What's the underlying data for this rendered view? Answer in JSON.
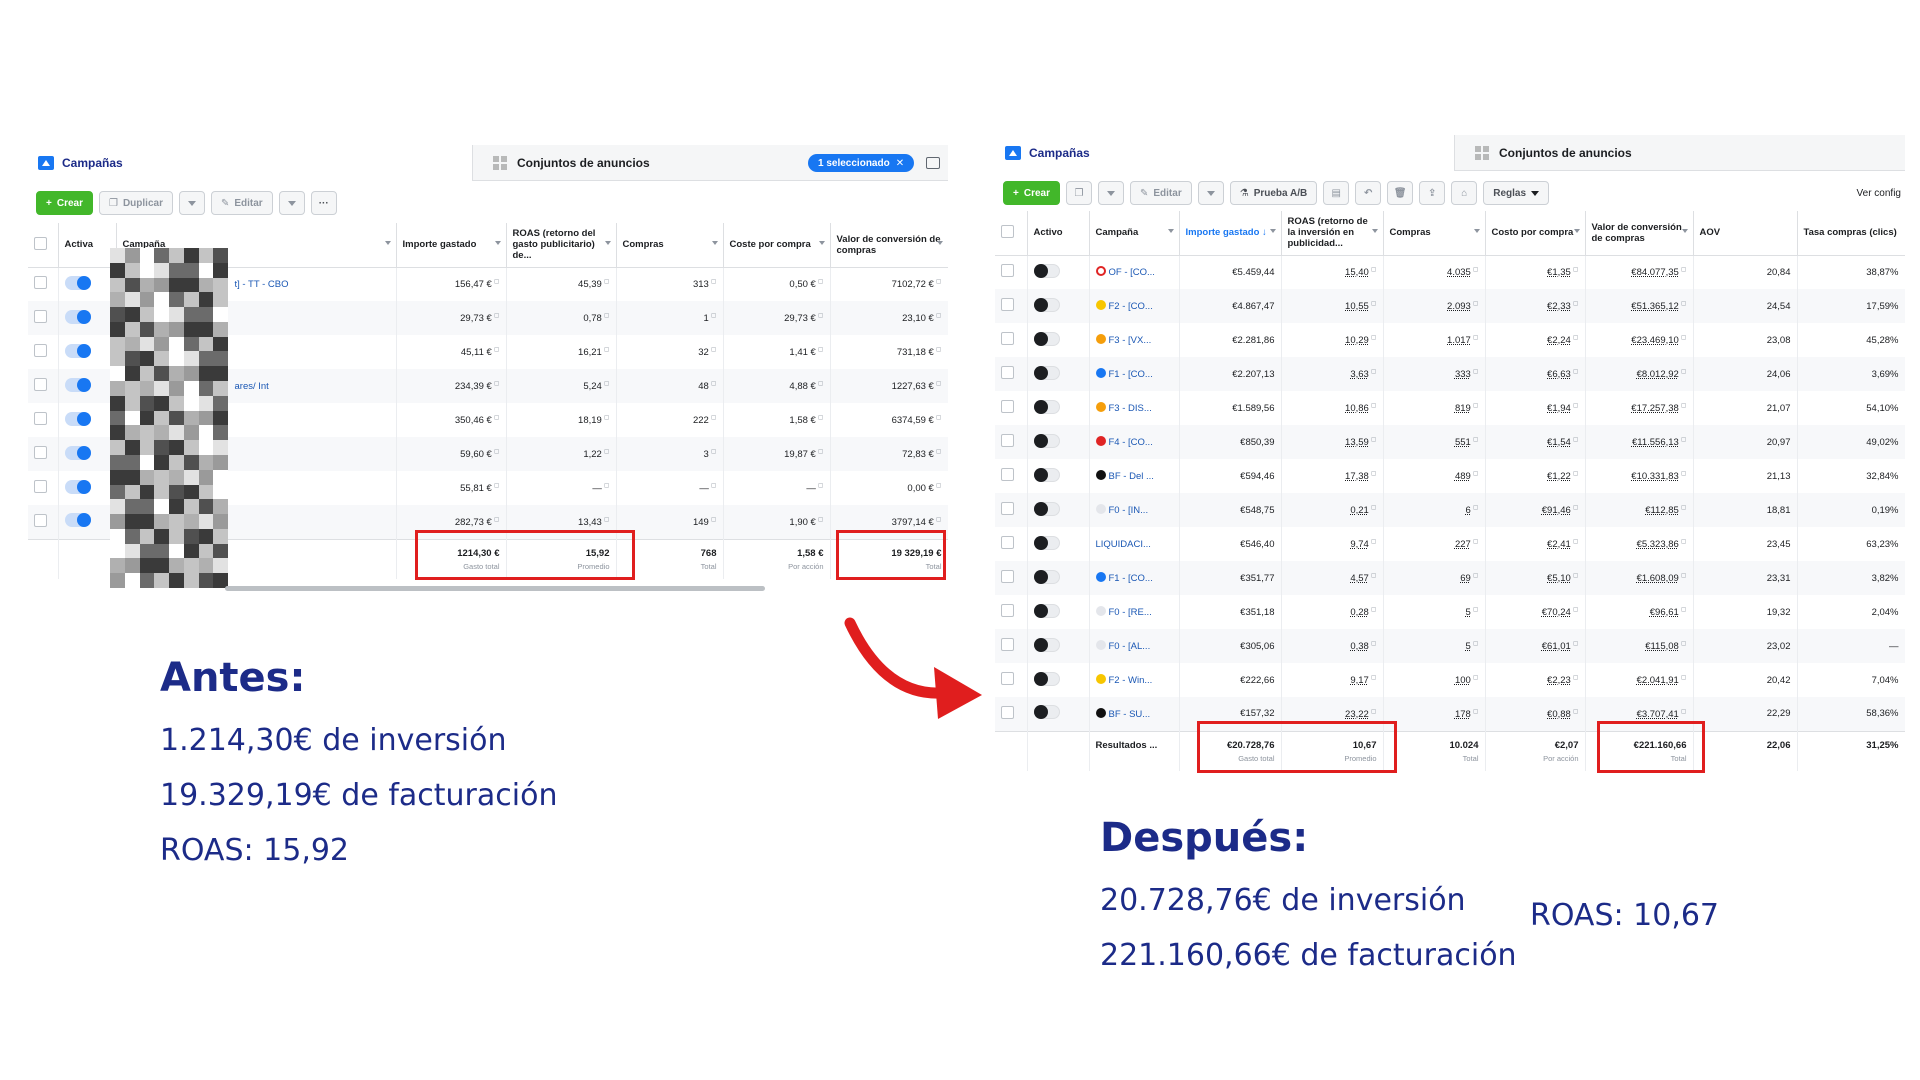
{
  "before": {
    "tabs": {
      "campaigns": "Campañas",
      "adsets": "Conjuntos de anuncios",
      "selected": "1 seleccionado"
    },
    "toolbar": {
      "create": "Crear",
      "duplicate": "Duplicar",
      "edit": "Editar",
      "more": "···"
    },
    "columns": [
      "Activa",
      "Campaña",
      "Importe gastado",
      "ROAS (retorno del gasto publicitario) de...",
      "Compras",
      "Coste por compra",
      "Valor de conversión de compras"
    ],
    "rows": [
      {
        "campaign": "t] - TT - CBO",
        "spend": "156,47 €",
        "roas": "45,39",
        "purchases": "313",
        "cpp": "0,50 €",
        "value": "7102,72 €"
      },
      {
        "campaign": "",
        "spend": "29,73 €",
        "roas": "0,78",
        "purchases": "1",
        "cpp": "29,73 €",
        "value": "23,10 €"
      },
      {
        "campaign": "",
        "spend": "45,11 €",
        "roas": "16,21",
        "purchases": "32",
        "cpp": "1,41 €",
        "value": "731,18 €"
      },
      {
        "campaign": "ares/ Int",
        "spend": "234,39 €",
        "roas": "5,24",
        "purchases": "48",
        "cpp": "4,88 €",
        "value": "1227,63 €"
      },
      {
        "campaign": "",
        "spend": "350,46 €",
        "roas": "18,19",
        "purchases": "222",
        "cpp": "1,58 €",
        "value": "6374,59 €"
      },
      {
        "campaign": "",
        "spend": "59,60 €",
        "roas": "1,22",
        "purchases": "3",
        "cpp": "19,87 €",
        "value": "72,83 €"
      },
      {
        "campaign": "",
        "spend": "55,81 €",
        "roas": "—",
        "purchases": "—",
        "cpp": "—",
        "value": "0,00 €"
      },
      {
        "campaign": "",
        "spend": "282,73 €",
        "roas": "13,43",
        "purchases": "149",
        "cpp": "1,90 €",
        "value": "3797,14 €"
      }
    ],
    "totals": {
      "spend": "1214,30 €",
      "spend_label": "Gasto total",
      "roas": "15,92",
      "roas_label": "Promedio",
      "purchases": "768",
      "purchases_label": "Total",
      "cpp": "1,58 €",
      "cpp_label": "Por acción",
      "value": "19 329,19 €",
      "value_label": "Total"
    }
  },
  "after": {
    "tabs": {
      "campaigns": "Campañas",
      "adsets": "Conjuntos de anuncios"
    },
    "toolbar": {
      "create": "Crear",
      "edit": "Editar",
      "ab_test": "Prueba A/B",
      "rules": "Reglas",
      "view_config": "Ver config"
    },
    "columns": [
      "Activo",
      "Campaña",
      "Importe gastado ↓",
      "ROAS (retorno de la inversión en publicidad...",
      "Compras",
      "Costo por compra",
      "Valor de conversión de compras",
      "AOV",
      "Tasa compras (clics)"
    ],
    "rows": [
      {
        "icon": "clock",
        "color": "#e02424",
        "campaign": "OF - [CO...",
        "spend": "€5.459,44",
        "roas": "15,40",
        "purchases": "4.035",
        "cpp": "€1,35",
        "value": "€84.077,35",
        "aov": "20,84",
        "rate": "38,87%"
      },
      {
        "icon": "dot",
        "color": "#f7c600",
        "campaign": "F2 - [CO...",
        "spend": "€4.867,47",
        "roas": "10,55",
        "purchases": "2.093",
        "cpp": "€2,33",
        "value": "€51.365,12",
        "aov": "24,54",
        "rate": "17,59%"
      },
      {
        "icon": "dot",
        "color": "#f59e0b",
        "campaign": "F3 - [VX...",
        "spend": "€2.281,86",
        "roas": "10,29",
        "purchases": "1.017",
        "cpp": "€2,24",
        "value": "€23.469,10",
        "aov": "23,08",
        "rate": "45,28%"
      },
      {
        "icon": "dot",
        "color": "#1877f2",
        "campaign": "F1 - [CO...",
        "spend": "€2.207,13",
        "roas": "3,63",
        "purchases": "333",
        "cpp": "€6,63",
        "value": "€8.012,92",
        "aov": "24,06",
        "rate": "3,69%"
      },
      {
        "icon": "dot",
        "color": "#f59e0b",
        "campaign": "F3 - DIS...",
        "spend": "€1.589,56",
        "roas": "10,86",
        "purchases": "819",
        "cpp": "€1,94",
        "value": "€17.257,38",
        "aov": "21,07",
        "rate": "54,10%"
      },
      {
        "icon": "dot",
        "color": "#e02424",
        "campaign": "F4 - [CO...",
        "spend": "€850,39",
        "roas": "13,59",
        "purchases": "551",
        "cpp": "€1,54",
        "value": "€11.556,13",
        "aov": "20,97",
        "rate": "49,02%"
      },
      {
        "icon": "dot",
        "color": "#111111",
        "campaign": "BF - Del ...",
        "spend": "€594,46",
        "roas": "17,38",
        "purchases": "489",
        "cpp": "€1,22",
        "value": "€10.331,83",
        "aov": "21,13",
        "rate": "32,84%"
      },
      {
        "icon": "dot",
        "color": "#e4e6eb",
        "campaign": "F0 - [IN...",
        "spend": "€548,75",
        "roas": "0,21",
        "purchases": "6",
        "cpp": "€91,46",
        "value": "€112,85",
        "aov": "18,81",
        "rate": "0,19%"
      },
      {
        "icon": "none",
        "color": "",
        "campaign": "LIQUIDACI...",
        "spend": "€546,40",
        "roas": "9,74",
        "purchases": "227",
        "cpp": "€2,41",
        "value": "€5.323,86",
        "aov": "23,45",
        "rate": "63,23%"
      },
      {
        "icon": "dot",
        "color": "#1877f2",
        "campaign": "F1 - [CO...",
        "spend": "€351,77",
        "roas": "4,57",
        "purchases": "69",
        "cpp": "€5,10",
        "value": "€1.608,09",
        "aov": "23,31",
        "rate": "3,82%"
      },
      {
        "icon": "dot",
        "color": "#e4e6eb",
        "campaign": "F0 - [RE...",
        "spend": "€351,18",
        "roas": "0,28",
        "purchases": "5",
        "cpp": "€70,24",
        "value": "€96,61",
        "aov": "19,32",
        "rate": "2,04%"
      },
      {
        "icon": "dot",
        "color": "#e4e6eb",
        "campaign": "F0 - [AL...",
        "spend": "€305,06",
        "roas": "0,38",
        "purchases": "5",
        "cpp": "€61,01",
        "value": "€115,08",
        "aov": "23,02",
        "rate": "—"
      },
      {
        "icon": "dot",
        "color": "#f7c600",
        "campaign": "F2 - Win...",
        "spend": "€222,66",
        "roas": "9,17",
        "purchases": "100",
        "cpp": "€2,23",
        "value": "€2.041,91",
        "aov": "20,42",
        "rate": "7,04%"
      },
      {
        "icon": "dot",
        "color": "#111111",
        "campaign": "BF - SU...",
        "spend": "€157,32",
        "roas": "23,22",
        "purchases": "178",
        "cpp": "€0,88",
        "value": "€3.707,41",
        "aov": "22,29",
        "rate": "58,36%"
      }
    ],
    "totals": {
      "label": "Resultados ...",
      "spend": "€20.728,76",
      "spend_label": "Gasto total",
      "roas": "10,67",
      "roas_label": "Promedio",
      "purchases": "10.024",
      "purchases_label": "Total",
      "cpp": "€2,07",
      "cpp_label": "Por acción",
      "value": "€221.160,66",
      "value_label": "Total",
      "aov": "22,06",
      "rate": "31,25%"
    }
  },
  "captions": {
    "before": {
      "title": "Antes:",
      "line1": "1.214,30€ de inversión",
      "line2": "19.329,19€ de facturación",
      "line3": "ROAS: 15,92"
    },
    "after": {
      "title": "Después:",
      "line1": "20.728,76€ de inversión",
      "line2": "221.160,66€ de facturación",
      "roas": "ROAS: 10,67"
    }
  },
  "colors": {
    "accent": "#1877f2",
    "highlight": "#e01e1e",
    "caption": "#1c2b88",
    "create": "#42b72a"
  }
}
